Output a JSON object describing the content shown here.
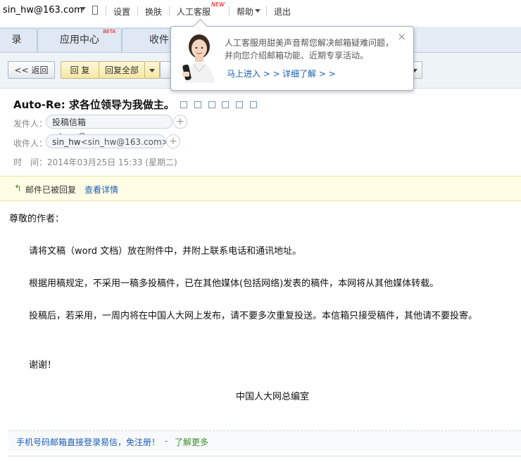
{
  "topbar": {
    "user": "sin_hw@163.com",
    "settings": "设置",
    "skin": "换肤",
    "service": "人工客服",
    "new_badge": "NEW",
    "help": "帮助",
    "logout": "退出"
  },
  "tabs": {
    "partial_left": "录",
    "app_center": "应用中心",
    "beta": "BETA",
    "inbox_partial": "收件"
  },
  "toolbar": {
    "back": "<< 返回",
    "reply": "回 复",
    "reply_all": "回复全部"
  },
  "popup": {
    "message": "人工客服用甜美声音帮您解决邮箱疑难问题，并向您介绍邮箱功能、近期专享活动。",
    "enter_link": "马上进入 > >",
    "detail_link": "详细了解 > >",
    "close": "×"
  },
  "mail": {
    "subject": "Auto-Re: 求各位领导为我做主。",
    "from_label": "发件人：",
    "from_name": "投稿信箱",
    "from_addr": "<tgxx@npc.gov.cn>",
    "to_label": "收件人：",
    "to_name": "sin_hw",
    "to_addr": "<sin_hw@163.com>",
    "time_label": "时　间：",
    "time_value": "2014年03月25日 15:33 (星期二)",
    "plus": "+"
  },
  "replied": {
    "text": "邮件已被回复",
    "link": "查看详情"
  },
  "body": {
    "greeting": "尊敬的作者：",
    "p1": "请将文稿（word 文档）放在附件中，并附上联系电话和通讯地址。",
    "p2": "根据用稿规定，不采用一稿多投稿件，已在其他媒体(包括网络)发表的稿件，本网将从其他媒体转载。",
    "p3": "投稿后，若采用，一周内将在中国人大网上发布，请不要多次重复投送。本信箱只接受稿件，其他请不要投寄。",
    "thanks": "谢谢！",
    "signature": "中国人大网总编室"
  },
  "footer": {
    "promo": "手机号码邮箱直接登录易信，免注册！",
    "dash": "-",
    "more": "了解更多"
  }
}
